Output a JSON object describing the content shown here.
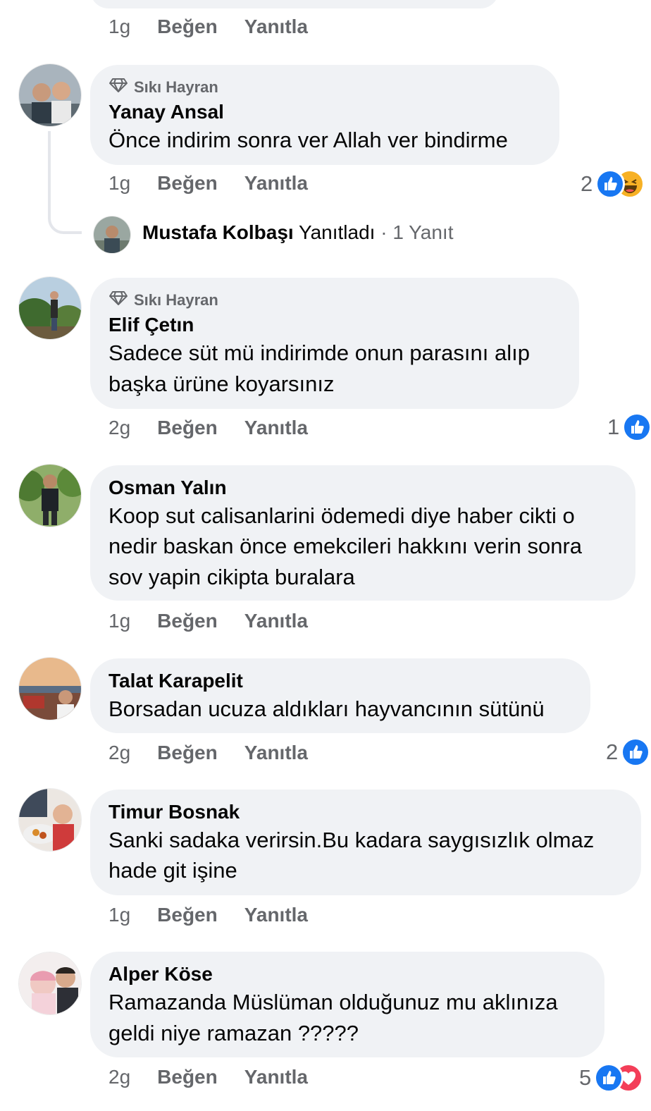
{
  "top_meta": {
    "age": "1g",
    "like": "Beğen",
    "reply": "Yanıtla"
  },
  "comments": [
    {
      "badge": "Sıkı Hayran",
      "name": "Yanay Ansal",
      "lines": [
        "Önce indirim sonra ver Allah ver bindirme"
      ],
      "age": "1g",
      "like": "Beğen",
      "reply": "Yanıtla",
      "reaction_count": "2"
    },
    {
      "badge": "Sıkı Hayran",
      "name": "Elif Çetın",
      "lines": [
        "Sadece süt mü indirimde onun parasını alıp",
        "başka ürüne koyarsınız"
      ],
      "age": "2g",
      "like": "Beğen",
      "reply": "Yanıtla",
      "reaction_count": "1"
    },
    {
      "name": "Osman Yalın",
      "lines": [
        "Koop sut calisanlarini ödemedi diye haber cikti o",
        "nedir baskan önce emekcileri hakkını verin sonra",
        "sov yapin cikipta buralara"
      ],
      "age": "1g",
      "like": "Beğen",
      "reply": "Yanıtla"
    },
    {
      "name": "Talat Karapelit",
      "lines": [
        "Borsadan ucuza aldıkları hayvancının sütünü"
      ],
      "age": "2g",
      "like": "Beğen",
      "reply": "Yanıtla",
      "reaction_count": "2"
    },
    {
      "name": "Timur Bosnak",
      "lines": [
        "Sanki sadaka verirsin.Bu kadara saygısızlık olmaz",
        "hade git işine"
      ],
      "age": "1g",
      "like": "Beğen",
      "reply": "Yanıtla"
    },
    {
      "name": "Alper Köse",
      "lines": [
        "Ramazanda Müslüman olduğunuz mu aklınıza",
        "geldi niye ramazan ?????"
      ],
      "age": "2g",
      "like": "Beğen",
      "reply": "Yanıtla",
      "reaction_count": "5"
    }
  ],
  "reply_summary": {
    "name": "Mustafa Kolbaşı",
    "action": "Yanıtladı",
    "separator": "·",
    "count": "1 Yanıt"
  },
  "colors": {
    "bubble": "#f0f2f5",
    "secondary_text": "#65676b",
    "like_blue": "#1877f2",
    "love_red": "#f33e58",
    "haha_yellow": "#f7b125"
  },
  "icons": {
    "badge": "diamond-icon",
    "like": "like-reaction-icon",
    "haha": "haha-reaction-icon",
    "love": "love-reaction-icon"
  }
}
